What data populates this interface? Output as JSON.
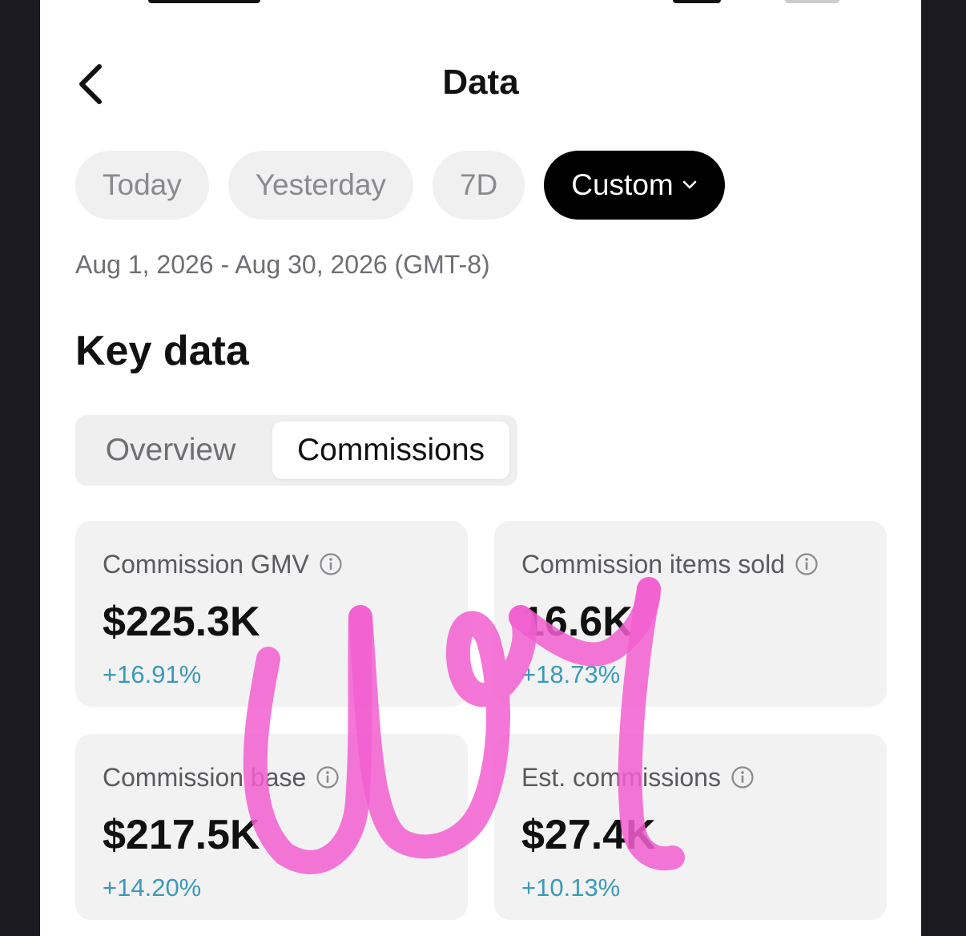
{
  "header": {
    "title": "Data"
  },
  "filters": {
    "chips": [
      {
        "label": "Today",
        "active": false
      },
      {
        "label": "Yesterday",
        "active": false
      },
      {
        "label": "7D",
        "active": false
      },
      {
        "label": "Custom",
        "active": true
      }
    ],
    "date_range": "Aug 1, 2026 - Aug 30, 2026 (GMT-8)"
  },
  "key_data": {
    "title": "Key data",
    "tabs": [
      {
        "label": "Overview",
        "active": false
      },
      {
        "label": "Commissions",
        "active": true
      }
    ],
    "cards": [
      {
        "label": "Commission GMV",
        "value": "$225.3K",
        "change": "+16.91%"
      },
      {
        "label": "Commission items sold",
        "value": "16.6K",
        "change": "+18.73%"
      },
      {
        "label": "Commission base",
        "value": "$217.5K",
        "change": "+14.20%"
      },
      {
        "label": "Est. commissions",
        "value": "$27.4K",
        "change": "+10.13%"
      }
    ]
  },
  "colors": {
    "accent_change": "#3a9ab8",
    "active_chip": "#000000",
    "overlay_scribble": "#f25fd0"
  },
  "icons": {
    "back": "chevron-left-icon",
    "dropdown": "chevron-down-icon",
    "info": "info-circle-icon"
  }
}
